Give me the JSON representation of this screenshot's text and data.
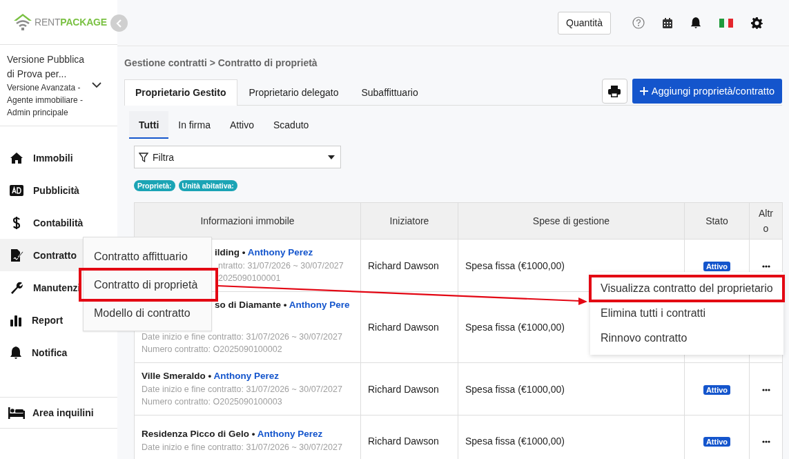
{
  "logo": {
    "word_1": "RENT",
    "word_2": "PACKAGE"
  },
  "account": {
    "title": "Versione Pubblica di Prova per...",
    "subtitle": "Versione Avanzata - Agente immobiliare - Admin principale"
  },
  "sidebar": {
    "items": [
      {
        "label": "Immobili",
        "selected": false
      },
      {
        "label": "Pubblicità",
        "selected": false
      },
      {
        "label": "Contabilità",
        "selected": false
      },
      {
        "label": "Contratto",
        "selected": true
      },
      {
        "label": "Manutenzi",
        "selected": false
      },
      {
        "label": "Report",
        "selected": false
      },
      {
        "label": "Notifica",
        "selected": false
      }
    ],
    "footer_item": {
      "label": "Area inquilini"
    }
  },
  "submenu": [
    {
      "label": "Contratto affittuario",
      "highlighted": false
    },
    {
      "label": "Contratto di proprietà",
      "highlighted": true
    },
    {
      "label": "Modello di contratto",
      "highlighted": false
    }
  ],
  "header": {
    "quantity_button": "Quantità"
  },
  "breadcrumb": "Gestione contratti > Contratto di proprietà",
  "tabs": [
    {
      "label": "Proprietario Gestito",
      "selected": true
    },
    {
      "label": "Proprietario delegato",
      "selected": false
    },
    {
      "label": "Subaffittuario",
      "selected": false
    }
  ],
  "add_button": "Aggiungi proprietà/contratto",
  "subtabs": [
    {
      "label": "Tutti",
      "selected": true
    },
    {
      "label": "In firma",
      "selected": false
    },
    {
      "label": "Attivo",
      "selected": false
    },
    {
      "label": "Scaduto",
      "selected": false
    }
  ],
  "filter": {
    "value": "Filtra"
  },
  "tags": [
    "Proprietà:",
    "Unità abitativa:"
  ],
  "table": {
    "columns": [
      "Informazioni immobile",
      "Iniziatore",
      "Spese di gestione",
      "Stato",
      "Altro"
    ],
    "rows": [
      {
        "lines": [
          {
            "kind": "title",
            "name": "ilding",
            "separator": "•",
            "owner": "Anthony Perez",
            "covered": true
          },
          {
            "kind": "detail",
            "text": "ntratto: 31/07/2026 ~ 30/07/2027",
            "covered": true
          },
          {
            "kind": "detail",
            "text": "2025090100001",
            "covered": true
          }
        ],
        "initiator": "Richard Dawson",
        "fee": "Spesa fissa (€1000,00)",
        "status": "Attivo"
      },
      {
        "lines": [
          {
            "kind": "title",
            "name": "so di Diamante",
            "separator": "•",
            "owner": "Anthony Pere",
            "covered": true
          },
          {
            "kind": "detail",
            "text": "Date inizio e fine contratto: 31/07/2026 ~ 30/07/2027",
            "covered": false
          },
          {
            "kind": "detail",
            "text": "Numero contratto: O2025090100002",
            "covered": false
          }
        ],
        "initiator": "Richard Dawson",
        "fee": "Spesa fissa (€1000,00)"
      },
      {
        "lines": [
          {
            "kind": "title",
            "name": "Ville Smeraldo",
            "separator": "•",
            "owner": "Anthony Perez",
            "covered": false
          },
          {
            "kind": "detail",
            "text": "Date inizio e fine contratto: 31/07/2026 ~ 30/07/2027",
            "covered": false
          },
          {
            "kind": "detail",
            "text": "Numero contratto: O2025090100003",
            "covered": false
          }
        ],
        "initiator": "Richard Dawson",
        "fee": "Spesa fissa (€1000,00)",
        "status": "Attivo"
      },
      {
        "lines": [
          {
            "kind": "title",
            "name": "Residenza Picco di Gelo",
            "separator": "•",
            "owner": "Anthony Perez",
            "covered": false
          },
          {
            "kind": "detail",
            "text": "Date inizio e fine contratto: 31/07/2026 ~ 30/07/2027",
            "covered": false
          }
        ],
        "initiator": "Richard Dawson",
        "fee": "Spesa fissa (€1000,00)",
        "status": "Attivo"
      }
    ]
  },
  "row_menu": [
    {
      "label": "Visualizza contratto del proprietario",
      "highlighted": true
    },
    {
      "label": "Elimina tutti i contratti",
      "highlighted": false
    },
    {
      "label": "Rinnovo contratto",
      "highlighted": false
    }
  ],
  "annotations": {
    "arrow": true
  }
}
